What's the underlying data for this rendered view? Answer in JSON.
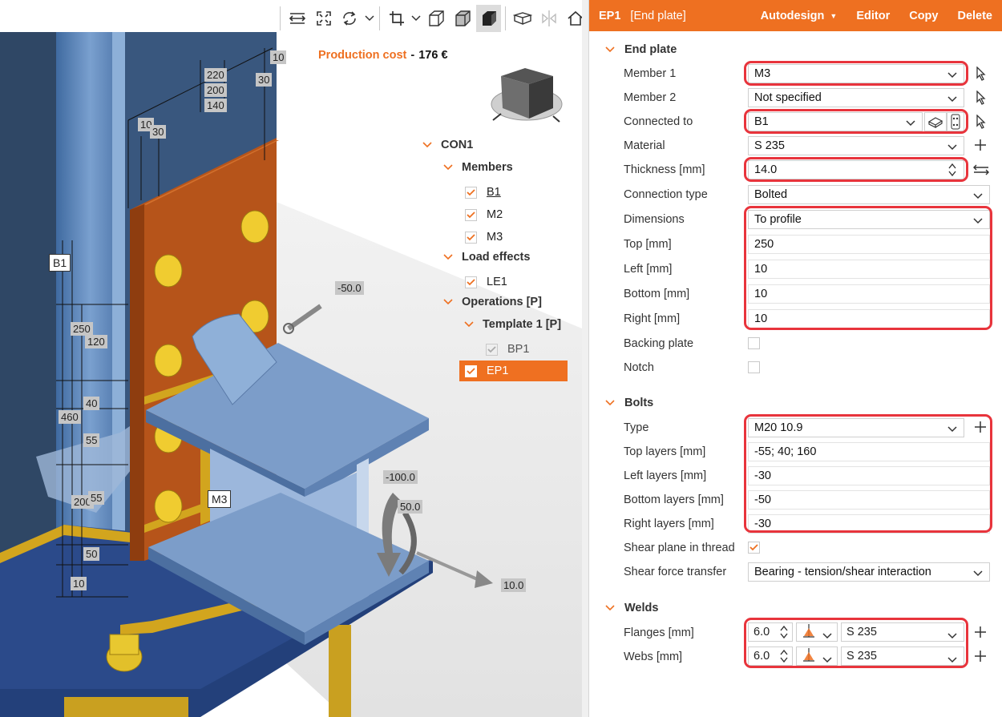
{
  "viewport": {
    "toolbar": {
      "icons": [
        "fit-width-icon",
        "fit-extent-icon",
        "rotate-icon",
        "crop-icon",
        "wireframe-cube-icon",
        "shaded-cube-icon",
        "solid-cube-icon",
        "section-view-icon",
        "mirror-icon",
        "home-icon"
      ]
    },
    "production_cost": {
      "label": "Production cost",
      "dash": "-",
      "value": "176 €"
    },
    "tree": {
      "root": "CON1",
      "members_label": "Members",
      "members": [
        "B1",
        "M2",
        "M3"
      ],
      "load_effects_label": "Load effects",
      "load_effects": [
        "LE1"
      ],
      "operations_label": "Operations [P]",
      "template_label": "Template 1 [P]",
      "ops": [
        "BP1",
        "EP1"
      ]
    },
    "labels": {
      "member_b1": "B1",
      "member_m3": "M3",
      "dims": [
        "10",
        "220",
        "200",
        "140",
        "30",
        "10",
        "30",
        "250",
        "120",
        "40",
        "460",
        "55",
        "200",
        "55",
        "50",
        "10"
      ],
      "loads": [
        "-50.0",
        "-100.0",
        "50.0",
        "10.0"
      ]
    }
  },
  "panel": {
    "header": {
      "id": "EP1",
      "type": "[End plate]",
      "autodesign": "Autodesign",
      "editor": "Editor",
      "copy": "Copy",
      "delete": "Delete"
    },
    "end_plate": {
      "title": "End plate",
      "member1": {
        "label": "Member 1",
        "value": "M3"
      },
      "member2": {
        "label": "Member 2",
        "value": "Not specified"
      },
      "connected_to": {
        "label": "Connected to",
        "value": "B1"
      },
      "material": {
        "label": "Material",
        "value": "S 235"
      },
      "thickness": {
        "label": "Thickness [mm]",
        "value": "14.0"
      },
      "connection_type": {
        "label": "Connection type",
        "value": "Bolted"
      },
      "dimensions": {
        "label": "Dimensions",
        "value": "To profile"
      },
      "top": {
        "label": "Top [mm]",
        "value": "250"
      },
      "left": {
        "label": "Left [mm]",
        "value": "10"
      },
      "bottom": {
        "label": "Bottom [mm]",
        "value": "10"
      },
      "right": {
        "label": "Right [mm]",
        "value": "10"
      },
      "backing_plate": {
        "label": "Backing plate",
        "checked": false
      },
      "notch": {
        "label": "Notch",
        "checked": false
      }
    },
    "bolts": {
      "title": "Bolts",
      "type": {
        "label": "Type",
        "value": "M20 10.9"
      },
      "top_layers": {
        "label": "Top layers [mm]",
        "value": "-55; 40; 160"
      },
      "left_layers": {
        "label": "Left layers [mm]",
        "value": "-30"
      },
      "bottom_layers": {
        "label": "Bottom layers [mm]",
        "value": "-50"
      },
      "right_layers": {
        "label": "Right layers [mm]",
        "value": "-30"
      },
      "shear_plane": {
        "label": "Shear plane in thread",
        "checked": true
      },
      "shear_transfer": {
        "label": "Shear force transfer",
        "value": "Bearing - tension/shear interaction"
      }
    },
    "welds": {
      "title": "Welds",
      "flanges": {
        "label": "Flanges [mm]",
        "size": "6.0",
        "material": "S 235"
      },
      "webs": {
        "label": "Webs [mm]",
        "size": "6.0",
        "material": "S 235"
      }
    }
  },
  "colors": {
    "accent": "#ee7021",
    "highlight": "#e8343c"
  }
}
